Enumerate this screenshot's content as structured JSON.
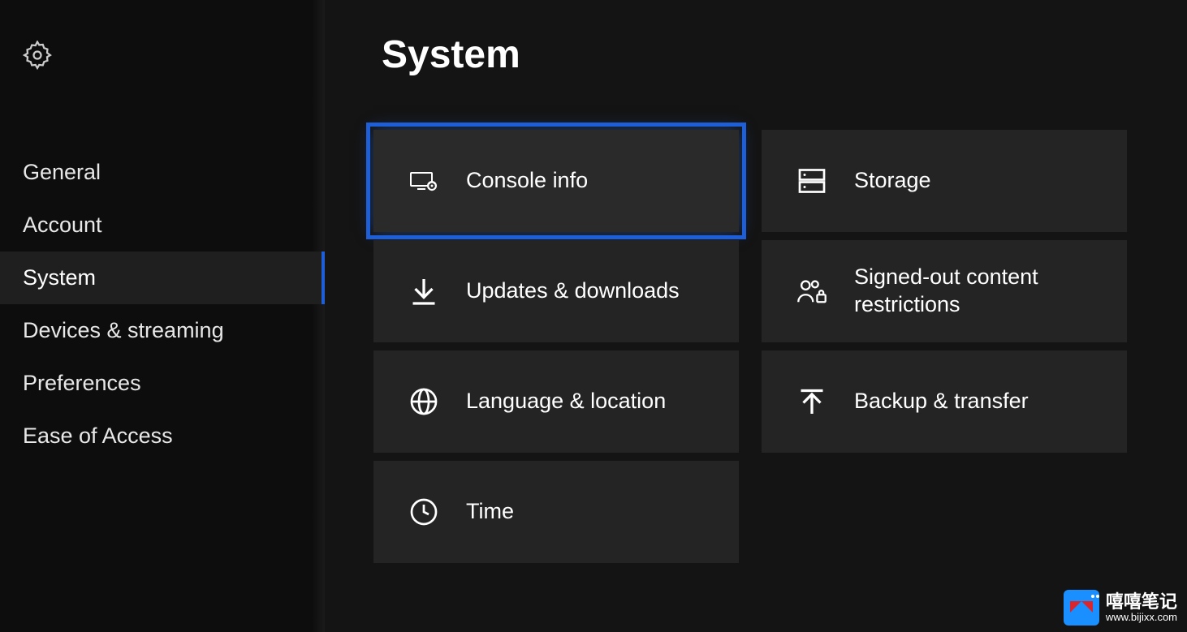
{
  "sidebar": {
    "items": [
      {
        "label": "General"
      },
      {
        "label": "Account"
      },
      {
        "label": "System"
      },
      {
        "label": "Devices & streaming"
      },
      {
        "label": "Preferences"
      },
      {
        "label": "Ease of Access"
      }
    ]
  },
  "main": {
    "title": "System",
    "tiles_left": [
      {
        "label": "Console info"
      },
      {
        "label": "Updates & downloads"
      },
      {
        "label": "Language & location"
      },
      {
        "label": "Time"
      }
    ],
    "tiles_right": [
      {
        "label": "Storage"
      },
      {
        "label": "Signed-out content restrictions"
      },
      {
        "label": "Backup & transfer"
      }
    ]
  },
  "watermark": {
    "cn": "嘻嘻笔记",
    "url": "www.bijixx.com"
  }
}
